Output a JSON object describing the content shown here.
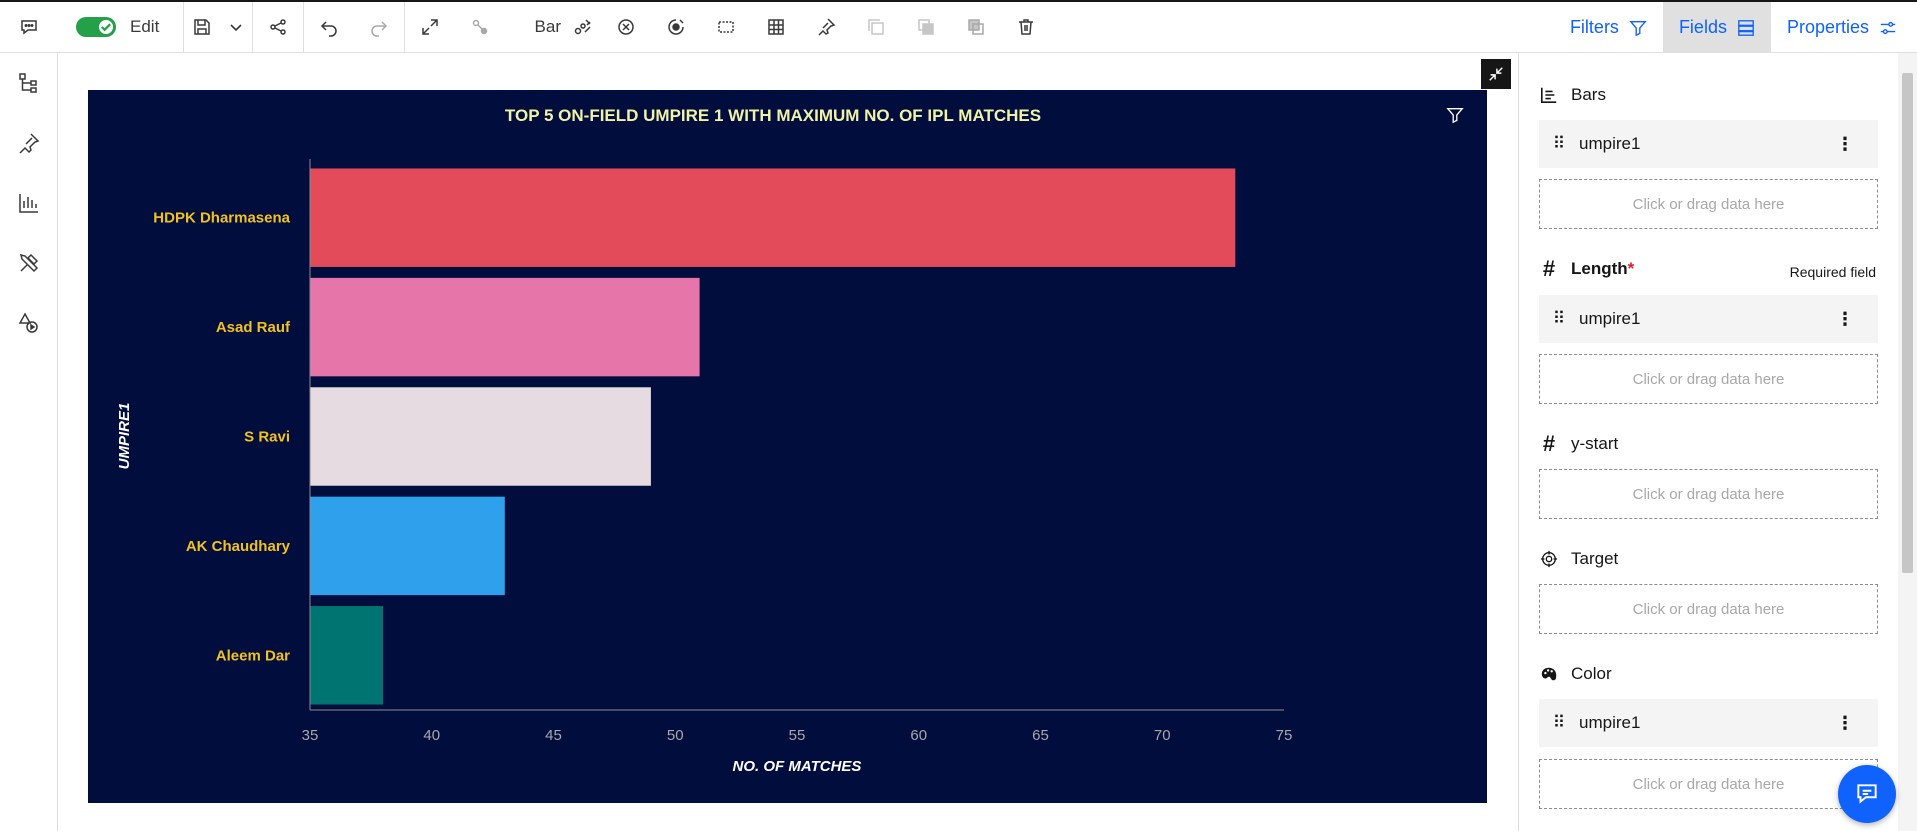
{
  "toolbar": {
    "edit_label": "Edit",
    "chart_type_label": "Bar"
  },
  "tabs": {
    "filters": "Filters",
    "fields": "Fields",
    "properties": "Properties"
  },
  "fields_panel": {
    "bars": {
      "label": "Bars",
      "field": "umpire1",
      "drop_text": "Click or drag data here"
    },
    "length": {
      "label": "Length",
      "required_mark": "*",
      "required_text": "Required field",
      "field": "umpire1",
      "drop_text": "Click or drag data here"
    },
    "ystart": {
      "label": "y-start",
      "drop_text": "Click or drag data here"
    },
    "target": {
      "label": "Target",
      "drop_text": "Click or drag data here"
    },
    "color": {
      "label": "Color",
      "field": "umpire1",
      "drop_text": "Click or drag data here"
    }
  },
  "colors": {
    "accent": "#0f62fe",
    "toggle_on": "#24a148",
    "chart_bg": "#000d3d",
    "title": "#f1f2a6",
    "category_label": "#f1c21b",
    "axis_text": "#a8a8a8"
  },
  "chart_data": {
    "type": "bar",
    "orientation": "horizontal",
    "title": "TOP 5 ON-FIELD UMPIRE 1 WITH MAXIMUM NO. OF IPL MATCHES",
    "xlabel": "NO. OF MATCHES",
    "ylabel": "UMPIRE1",
    "categories": [
      "HDPK Dharmasena",
      "Asad Rauf",
      "S Ravi",
      "AK Chaudhary",
      "Aleem Dar"
    ],
    "values": [
      73,
      51,
      49,
      43,
      38
    ],
    "bar_colors": [
      "#e34a5a",
      "#e676aa",
      "#e5dbe0",
      "#2ea0ec",
      "#007470"
    ],
    "xlim": [
      35,
      75
    ],
    "xticks": [
      35,
      40,
      45,
      50,
      55,
      60,
      65,
      70,
      75
    ],
    "grid": false
  }
}
